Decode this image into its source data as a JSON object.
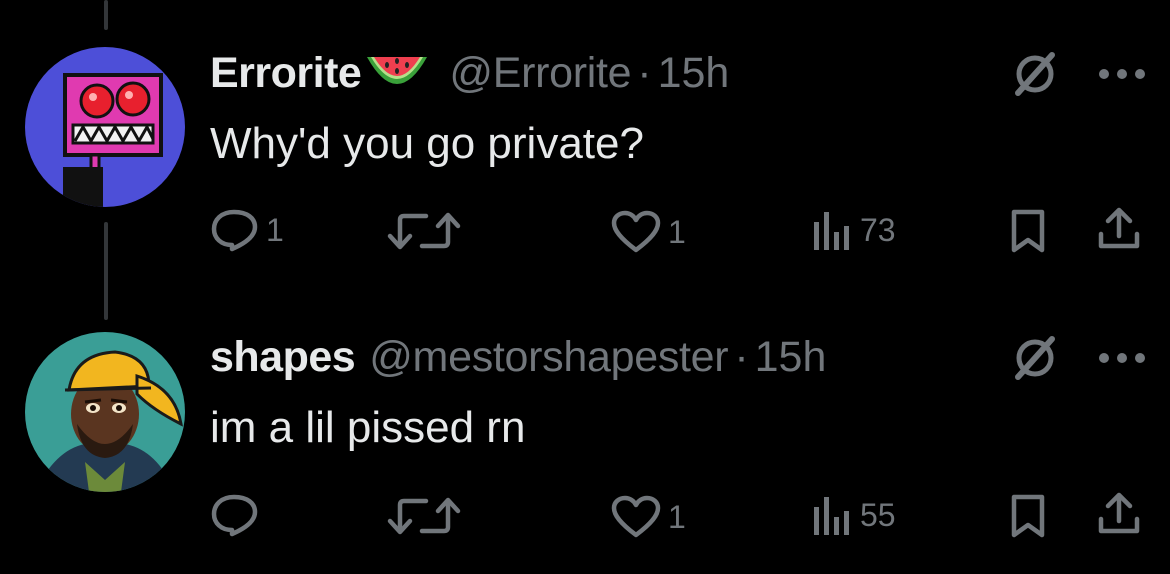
{
  "tweets": [
    {
      "display_name": "Errorite",
      "emoji_icon": "watermelon-icon",
      "handle": "@Errorite",
      "separator": "·",
      "time": "15h",
      "text": "Why'd you go private?",
      "actions": {
        "reply_count": "1",
        "repost_count": "",
        "like_count": "1",
        "views_count": "73"
      }
    },
    {
      "display_name": "shapes",
      "handle": "@mestorshapester",
      "separator": "·",
      "time": "15h",
      "text": "im a lil pissed rn",
      "actions": {
        "reply_count": "",
        "repost_count": "",
        "like_count": "1",
        "views_count": "55"
      }
    }
  ],
  "colors": {
    "background": "#000000",
    "primary_text": "#e7e9ea",
    "secondary_text": "#71767b",
    "thread_line": "#333639"
  }
}
